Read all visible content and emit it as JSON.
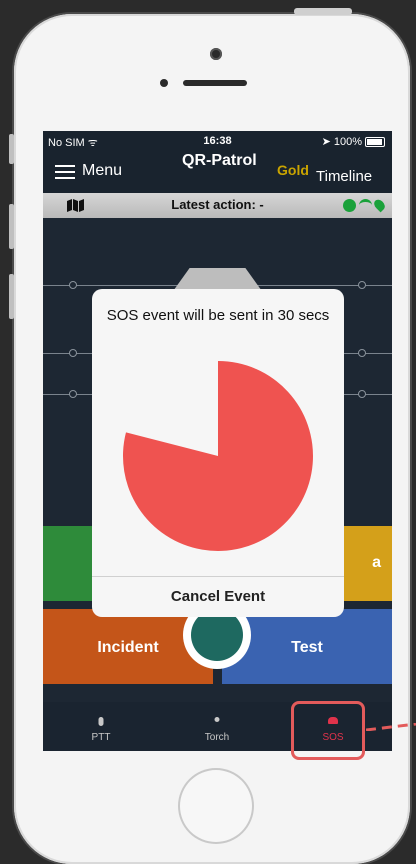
{
  "status_bar": {
    "carrier": "No SIM",
    "time": "16:38",
    "battery": "100%"
  },
  "nav": {
    "menu_label": "Menu",
    "app_title": "QR-Patrol",
    "plan_badge": "Gold",
    "timeline_label": "Timeline"
  },
  "action_bar": {
    "latest_action": "Latest action: -"
  },
  "tiles": {
    "right_top_label_fragment": "a",
    "incident_label": "Incident",
    "test_label": "Test"
  },
  "dialog": {
    "title": "SOS event will be sent in 30 secs",
    "countdown_progress": 0.79,
    "cancel_label": "Cancel Event"
  },
  "tabbar": {
    "tabs": [
      {
        "label": "PTT"
      },
      {
        "label": "Torch"
      },
      {
        "label": "SOS"
      }
    ]
  },
  "colors": {
    "sos_red": "#EF5350",
    "highlight_red": "#E35B5B",
    "gold": "#C9A400"
  }
}
